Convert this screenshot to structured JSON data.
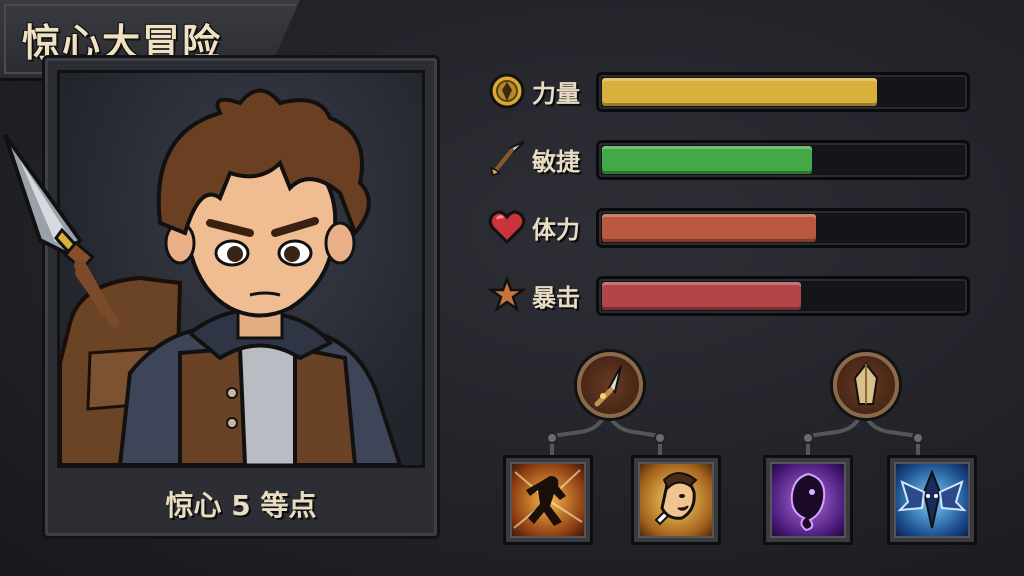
{
  "title": "惊心大冒险",
  "portrait": {
    "level_text": "惊心 5  等点"
  },
  "stats": [
    {
      "icon": "shield-badge-icon",
      "label": "力量",
      "value": 0.76,
      "color": "#d8b13c"
    },
    {
      "icon": "arrow-icon",
      "label": "敏捷",
      "value": 0.58,
      "color": "#43a845"
    },
    {
      "icon": "heart-icon",
      "label": "体力",
      "value": 0.59,
      "color": "#b8583c"
    },
    {
      "icon": "star-icon",
      "label": "暴击",
      "value": 0.55,
      "color": "#b2454a"
    }
  ],
  "skills": {
    "branch_a": {
      "node_icon": "spearhead-node-icon",
      "children": [
        "dash-skill-icon",
        "battle-cry-skill-icon"
      ]
    },
    "branch_b": {
      "node_icon": "crystal-node-icon",
      "children": [
        "shadow-skill-icon",
        "ice-wings-skill-icon"
      ]
    }
  }
}
